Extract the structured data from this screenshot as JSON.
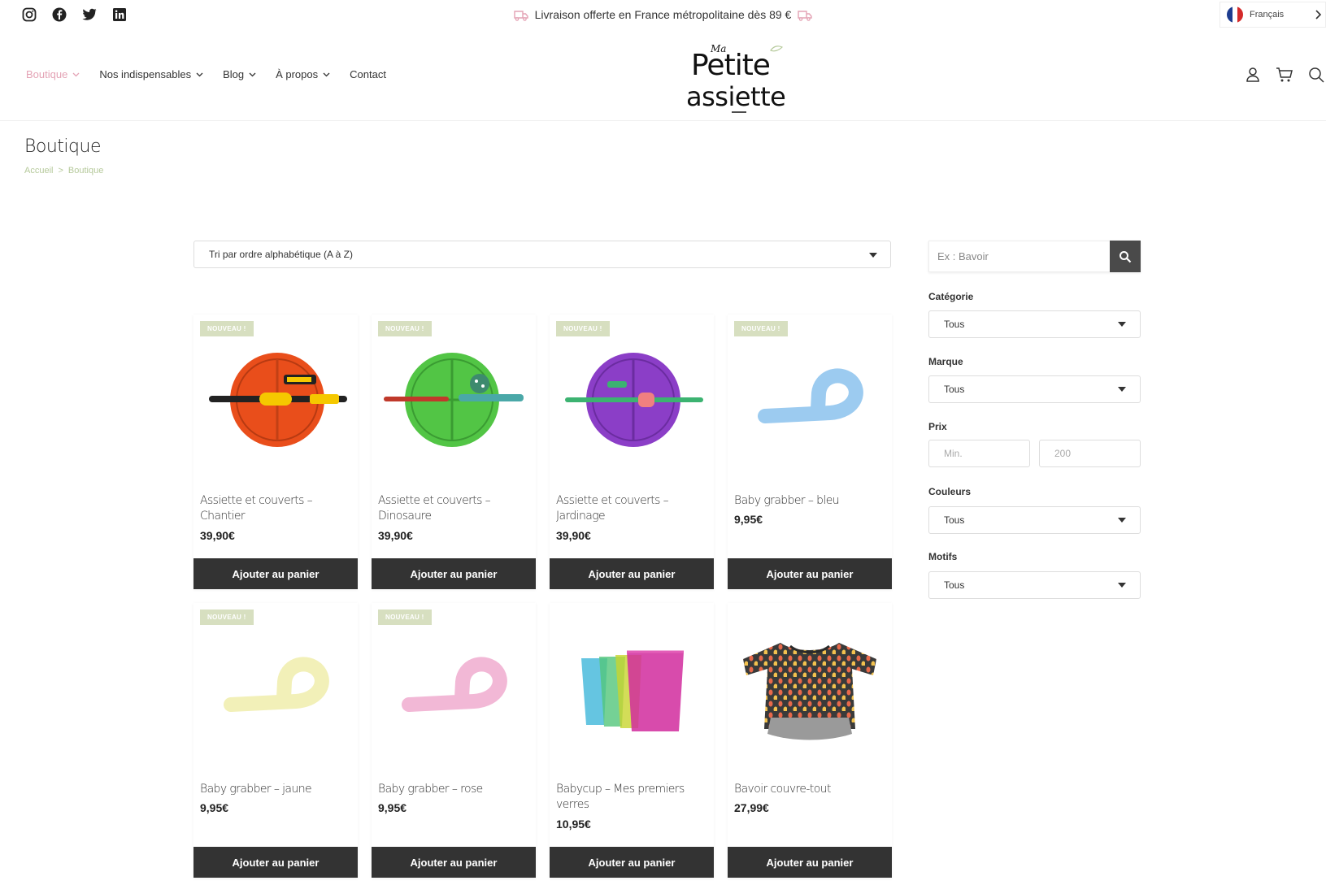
{
  "topbar": {
    "socials": [
      "instagram-icon",
      "facebook-icon",
      "twitter-icon",
      "linkedin-icon"
    ],
    "promo": "Livraison offerte en France métropolitaine dès 89 €",
    "language": "Français"
  },
  "nav": {
    "items": [
      {
        "label": "Boutique",
        "dropdown": true,
        "active": true
      },
      {
        "label": "Nos indispensables",
        "dropdown": true
      },
      {
        "label": "Blog",
        "dropdown": true
      },
      {
        "label": "À propos",
        "dropdown": true
      },
      {
        "label": "Contact",
        "dropdown": false
      }
    ],
    "logo": {
      "small": "Ma",
      "line1": "Petite",
      "line2": "assiette"
    }
  },
  "page": {
    "title": "Boutique",
    "breadcrumb": [
      "Accueil",
      ">",
      "Boutique"
    ]
  },
  "sort": {
    "selected": "Tri par ordre alphabétique (A à Z)"
  },
  "products": [
    {
      "name": "Assiette et couverts – Chantier",
      "price": "39,90€",
      "badge": "NOUVEAU !",
      "button": "Ajouter au panier"
    },
    {
      "name": "Assiette et couverts – Dinosaure",
      "price": "39,90€",
      "badge": "NOUVEAU !",
      "button": "Ajouter au panier"
    },
    {
      "name": "Assiette et couverts – Jardinage",
      "price": "39,90€",
      "badge": "NOUVEAU !",
      "button": "Ajouter au panier"
    },
    {
      "name": "Baby grabber – bleu",
      "price": "9,95€",
      "badge": "NOUVEAU !",
      "button": "Ajouter au panier"
    },
    {
      "name": "Baby grabber – jaune",
      "price": "9,95€",
      "badge": "NOUVEAU !",
      "button": "Ajouter au panier"
    },
    {
      "name": "Baby grabber – rose",
      "price": "9,95€",
      "badge": "NOUVEAU !",
      "button": "Ajouter au panier"
    },
    {
      "name": "Babycup – Mes premiers verres",
      "price": "10,95€",
      "badge": "",
      "button": "Ajouter au panier"
    },
    {
      "name": "Bavoir couvre-tout",
      "price": "27,99€",
      "badge": "",
      "button": "Ajouter au panier"
    }
  ],
  "sidebar": {
    "search_placeholder": "Ex : Bavoir",
    "filters": [
      {
        "label": "Catégorie",
        "value": "Tous"
      },
      {
        "label": "Marque",
        "value": "Tous"
      },
      {
        "label": "Couleurs",
        "value": "Tous"
      },
      {
        "label": "Motifs",
        "value": "Tous"
      }
    ],
    "price": {
      "label": "Prix",
      "min_placeholder": "Min.",
      "max_placeholder": "200"
    }
  },
  "colors": {
    "accent_pink": "#e4a3b5",
    "badge_green": "#d7dfc0",
    "dark_button": "#333333",
    "breadcrumb_green": "#b5c99a"
  }
}
